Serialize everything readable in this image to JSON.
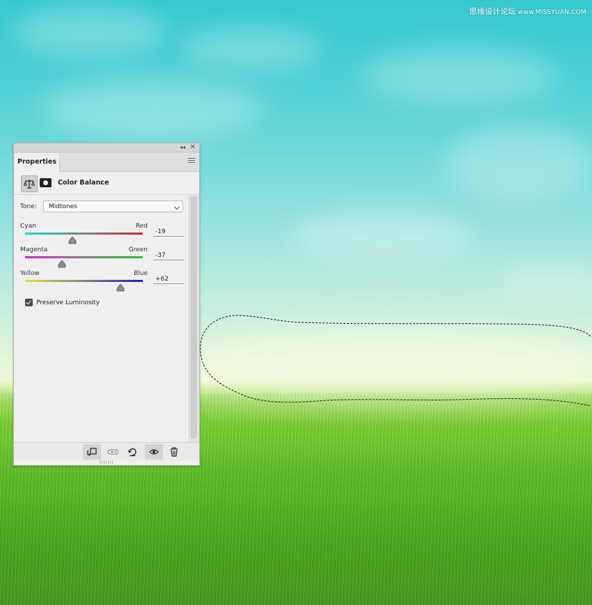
{
  "watermark": {
    "text": "思缘设计论坛",
    "url": "www.MISSYUAN.COM"
  },
  "panel": {
    "tab_label": "Properties",
    "title": "Color Balance",
    "tone": {
      "label": "Tone:",
      "value": "Midtones"
    },
    "sliders": [
      {
        "left": "Cyan",
        "right": "Red",
        "value": "-19",
        "fraction": 0.405,
        "colors": [
          "#15d4d1",
          "#d6202a"
        ]
      },
      {
        "left": "Magenta",
        "right": "Green",
        "value": "-37",
        "fraction": 0.315,
        "colors": [
          "#d21fd0",
          "#22c51e"
        ]
      },
      {
        "left": "Yellow",
        "right": "Blue",
        "value": "+62",
        "fraction": 0.81,
        "colors": [
          "#e8e419",
          "#1a1ec8"
        ]
      }
    ],
    "preserve_luminosity": {
      "label": "Preserve Luminosity",
      "checked": true
    }
  },
  "colors": {
    "panel_bg": "#efefef",
    "panel_border": "#b8b8b8",
    "text": "#222222"
  },
  "icons": {
    "adjustment": "balance-scale-icon",
    "mask": "layer-mask-icon",
    "clip": "clip-to-layer-icon",
    "view_previous": "view-previous-state-icon",
    "reset": "reset-icon",
    "visibility": "eye-icon",
    "delete": "trash-icon"
  }
}
